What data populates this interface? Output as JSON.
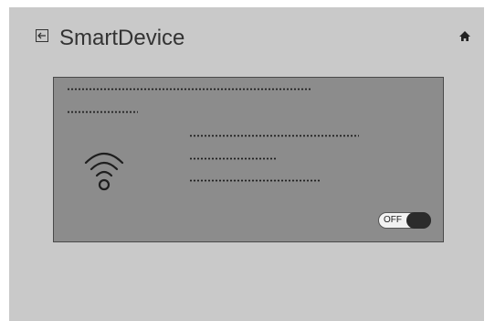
{
  "header": {
    "title": "SmartDevice",
    "back_icon": "back-arrow-icon",
    "home_icon": "home-icon"
  },
  "card": {
    "icon": "wifi-icon",
    "toggle": {
      "label": "OFF",
      "state": "off"
    }
  },
  "colors": {
    "screen_bg": "#c9c9c9",
    "card_bg": "#8c8c8c",
    "card_border": "#4a4a4a",
    "text": "#333333"
  }
}
